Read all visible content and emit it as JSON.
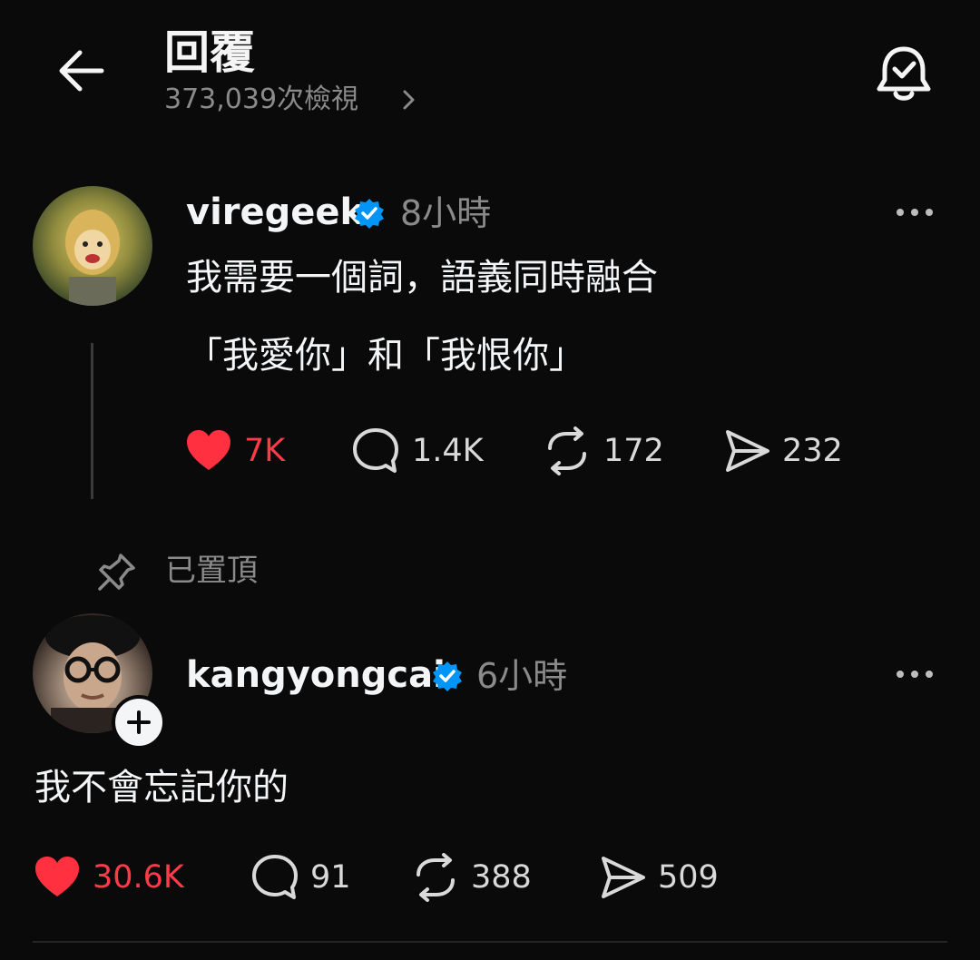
{
  "header": {
    "title": "回覆",
    "views": "373,039次檢視"
  },
  "posts": [
    {
      "username": "viregeek",
      "time": "8小時",
      "lines": [
        "我需要一個詞，語義同時融合",
        "「我愛你」和「我恨你」"
      ],
      "likes": "7K",
      "replies": "1.4K",
      "reposts": "172",
      "shares": "232"
    },
    {
      "pinned_label": "已置頂",
      "username": "kangyongcai",
      "time": "6小時",
      "lines": [
        "我不會忘記你的"
      ],
      "likes": "30.6K",
      "replies": "91",
      "reposts": "388",
      "shares": "509"
    }
  ],
  "colors": {
    "background": "#0a0a0a",
    "like_red": "#ff3040",
    "verified_blue": "#0095f6",
    "muted_text": "#8a8a8a"
  }
}
